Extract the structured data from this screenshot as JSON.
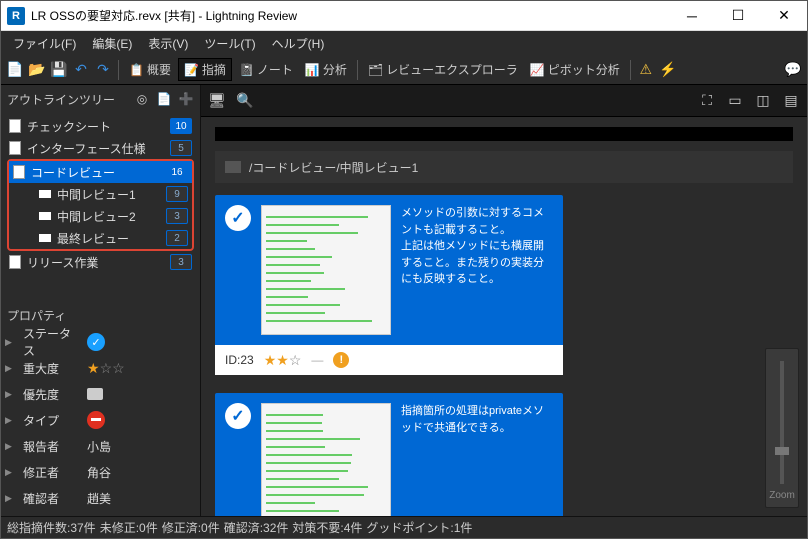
{
  "title": "LR OSSの要望対応.revx [共有] - Lightning Review",
  "menubar": [
    "ファイル(F)",
    "編集(E)",
    "表示(V)",
    "ツール(T)",
    "ヘルプ(H)"
  ],
  "toolbar": {
    "overview": "概要",
    "issue": "指摘",
    "note": "ノート",
    "analysis": "分析",
    "explorer": "レビューエクスプローラ",
    "pivot": "ピボット分析"
  },
  "outline": {
    "title": "アウトラインツリー",
    "items": [
      {
        "label": "チェックシート",
        "count": 10,
        "sel": false,
        "badge": "blue"
      },
      {
        "label": "インターフェース仕様",
        "count": 5,
        "sel": false,
        "badge": "outline"
      },
      {
        "label": "コードレビュー",
        "count": 16,
        "sel": true,
        "badge": "blue"
      },
      {
        "label": "中間レビュー1",
        "count": 9,
        "sel": false,
        "ind": true,
        "badge": "outline"
      },
      {
        "label": "中間レビュー2",
        "count": 3,
        "sel": false,
        "ind": true,
        "badge": "outline"
      },
      {
        "label": "最終レビュー",
        "count": 2,
        "sel": false,
        "ind": true,
        "badge": "outline"
      },
      {
        "label": "リリース作業",
        "count": 3,
        "sel": false,
        "badge": "outline"
      }
    ]
  },
  "properties": {
    "title": "プロパティ",
    "rows": [
      {
        "label": "ステータス",
        "kind": "check"
      },
      {
        "label": "重大度",
        "kind": "stars",
        "filled": 1,
        "total": 3
      },
      {
        "label": "優先度",
        "kind": "gray"
      },
      {
        "label": "タイプ",
        "kind": "red"
      },
      {
        "label": "報告者",
        "kind": "text",
        "value": "小島"
      },
      {
        "label": "修正者",
        "kind": "text",
        "value": "角谷"
      },
      {
        "label": "確認者",
        "kind": "text",
        "value": "趙美"
      }
    ]
  },
  "breadcrumb": "/コードレビュー/中間レビュー1",
  "cards": [
    {
      "text": "メソッドの引数に対するコメントも記載すること。\n上記は他メソッドにも横展開すること。また残りの実装分にも反映すること。",
      "footer": {
        "id": "ID:23",
        "stars_filled": 2,
        "stars_total": 3,
        "dash": "—",
        "warn": "!"
      }
    },
    {
      "text": "指摘箇所の処理はprivateメソッドで共通化できる。"
    }
  ],
  "zoom": "Zoom",
  "status": {
    "total": "総指摘件数:37件",
    "unfixed": "未修正:0件",
    "fixed": "修正済:0件",
    "confirmed": "確認済:32件",
    "noaction": "対策不要:4件",
    "good": "グッドポイント:1件"
  }
}
